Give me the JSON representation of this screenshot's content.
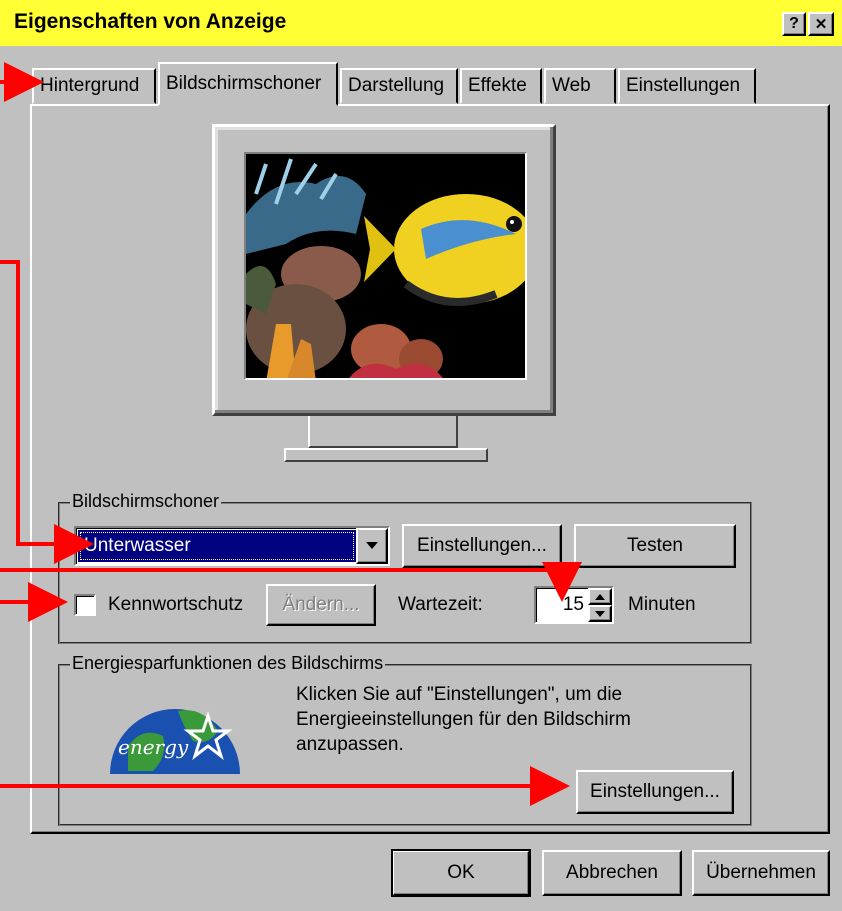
{
  "window": {
    "title": "Eigenschaften von Anzeige",
    "help_glyph": "?",
    "close_glyph": "✕"
  },
  "tabs": [
    {
      "label": "Hintergrund"
    },
    {
      "label": "Bildschirmschoner"
    },
    {
      "label": "Darstellung"
    },
    {
      "label": "Effekte"
    },
    {
      "label": "Web"
    },
    {
      "label": "Einstellungen"
    }
  ],
  "screensaver": {
    "group_title": "Bildschirmschoner",
    "selected": "Unterwasser",
    "settings_button": "Einstellungen...",
    "test_button": "Testen",
    "password_label": "Kennwortschutz",
    "change_button": "Ändern...",
    "wait_label": "Wartezeit:",
    "wait_value": "15",
    "minutes_label": "Minuten"
  },
  "energy": {
    "group_title": "Energiesparfunktionen des Bildschirms",
    "description": "Klicken Sie auf \"Einstellungen\", um die Energieeinstellungen für den Bildschirm anzupassen.",
    "settings_button": "Einstellungen...",
    "logo_text": "energy"
  },
  "footer": {
    "ok_button": "OK",
    "cancel_button": "Abbrechen",
    "apply_button": "Übernehmen"
  },
  "colors": {
    "title_bar": "#ffff33",
    "selection": "#000080",
    "arrow": "#ff0000"
  }
}
